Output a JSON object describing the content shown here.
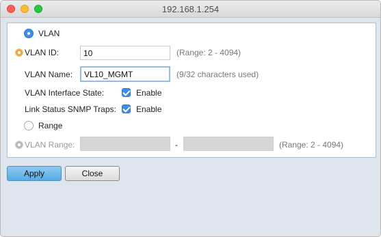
{
  "window": {
    "title": "192.168.1.254"
  },
  "form": {
    "vlan_radio_label": "VLAN",
    "vlan_id_label": "VLAN ID:",
    "vlan_id_value": "10",
    "vlan_id_hint": "(Range: 2 - 4094)",
    "vlan_name_label": "VLAN Name:",
    "vlan_name_value": "VL10_MGMT",
    "vlan_name_hint": "(9/32 characters used)",
    "interface_state_label": "VLAN Interface State:",
    "interface_state_option": "Enable",
    "snmp_traps_label": "Link Status SNMP Traps:",
    "snmp_traps_option": "Enable",
    "range_radio_label": "Range",
    "vlan_range_label": "VLAN Range:",
    "vlan_range_separator": "-",
    "vlan_range_hint": "(Range: 2 - 4094)",
    "selected_mode": "VLAN",
    "interface_state_checked": true,
    "snmp_traps_checked": true
  },
  "buttons": {
    "apply": "Apply",
    "close": "Close"
  },
  "colors": {
    "accent": "#3b8eea",
    "required_icon": "#f0a23b",
    "disabled_icon": "#b5b5b5"
  },
  "icons": {
    "required": "gear-icon",
    "disabled": "gear-icon"
  }
}
